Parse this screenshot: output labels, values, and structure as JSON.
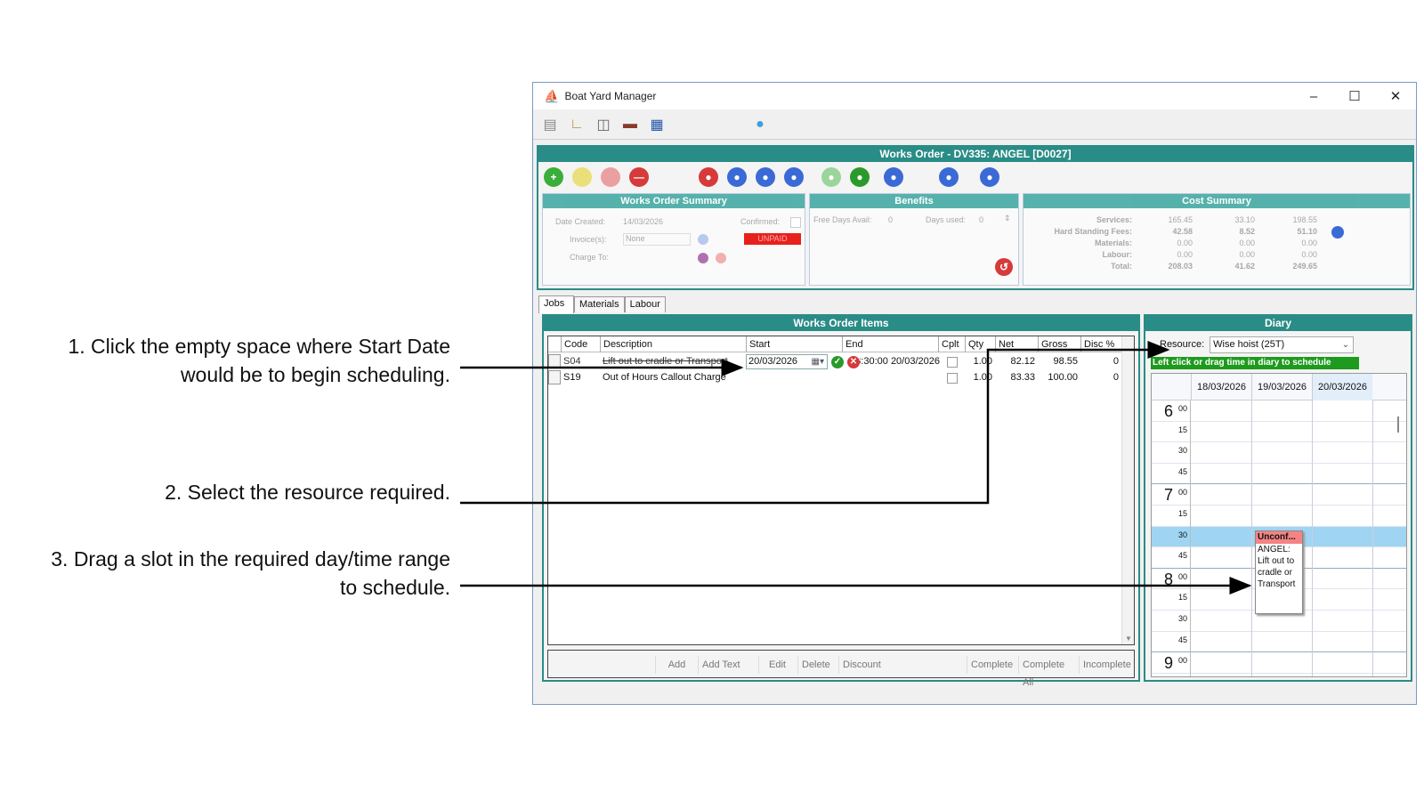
{
  "annotations": {
    "step1": "1. Click the empty space where Start Date would be to begin scheduling.",
    "step2": "2. Select the resource required.",
    "step3": "3. Drag a slot in the required day/time range to schedule."
  },
  "window": {
    "title": "Boat Yard Manager",
    "minimize": "–",
    "maximize": "☐",
    "close": "✕"
  },
  "toolbar_icons": [
    "cylinder-icon",
    "crane-icon",
    "book-icon",
    "boat-icon",
    "bar-chart-icon",
    "help-bubble-icon"
  ],
  "works_order": {
    "header": "Works Order - DV335: ANGEL [D0027]",
    "summary": {
      "title": "Works Order Summary",
      "date_created_label": "Date Created:",
      "date_created": "14/03/2026",
      "confirmed_label": "Confirmed:",
      "invoices_label": "Invoice(s):",
      "invoices_value": "None",
      "status_badge": "UNPAID",
      "charge_to_label": "Charge To:"
    },
    "benefits": {
      "title": "Benefits",
      "free_days_label": "Free Days Avail:",
      "free_days": "0",
      "days_used_label": "Days used:",
      "days_used": "0"
    },
    "cost_summary": {
      "title": "Cost Summary",
      "rows": [
        {
          "label": "Services:",
          "net": "165.45",
          "vat": "33.10",
          "gross": "198.55"
        },
        {
          "label": "Hard Standing Fees:",
          "net": "42.58",
          "vat": "8.52",
          "gross": "51.10"
        },
        {
          "label": "Materials:",
          "net": "0.00",
          "vat": "0.00",
          "gross": "0.00"
        },
        {
          "label": "Labour:",
          "net": "0.00",
          "vat": "0.00",
          "gross": "0.00"
        },
        {
          "label": "Total:",
          "net": "208.03",
          "vat": "41.62",
          "gross": "249.65"
        }
      ]
    }
  },
  "tabs": [
    "Jobs",
    "Materials",
    "Labour"
  ],
  "items": {
    "title": "Works Order Items",
    "columns": [
      "Code",
      "Description",
      "Start",
      "End",
      "Cplt",
      "Qty",
      "Net",
      "Gross",
      "Disc %"
    ],
    "rows": [
      {
        "code": "S04",
        "description": "Lift out to cradle or Transport",
        "start": "20/03/2026",
        "end": "20/03/2026 08:30:00",
        "qty": "1.00",
        "net": "82.12",
        "gross": "98.55",
        "disc": "0"
      },
      {
        "code": "S19",
        "description": "Out of Hours Callout Charge",
        "start": "",
        "end": "",
        "qty": "1.00",
        "net": "83.33",
        "gross": "100.00",
        "disc": "0"
      }
    ],
    "buttons": [
      "Add",
      "Add Text",
      "Edit",
      "Delete",
      "Discount",
      "Complete",
      "Complete All",
      "Incomplete"
    ]
  },
  "diary": {
    "title": "Diary",
    "resource_label": "Resource:",
    "resource_value": "Wise hoist (25T)",
    "hint": "Left click or drag time in diary to schedule",
    "days": [
      "18/03/2026",
      "19/03/2026",
      "20/03/2026"
    ],
    "hours": [
      "6",
      "7",
      "8",
      "9"
    ],
    "minutes": [
      "00",
      "15",
      "30",
      "45"
    ],
    "appointment": {
      "header": "Unconf...",
      "body": "ANGEL:\nLift out to\ncradle or\nTransport"
    }
  },
  "colors": {
    "teal": "#2a8c86",
    "unpaid": "#e8201c",
    "hint_green": "#1e9a1e",
    "appointment_header": "#f48484",
    "selected_slot": "#9fd5f2"
  }
}
